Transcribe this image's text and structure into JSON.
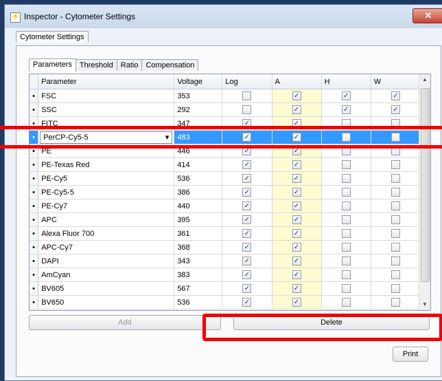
{
  "window": {
    "title": "Inspector - Cytometer Settings",
    "close_label": "✕",
    "app_icon": "⚡"
  },
  "outer_tab": "Cytometer Settings",
  "inner_tabs": [
    "Parameters",
    "Threshold",
    "Ratio",
    "Compensation"
  ],
  "columns": {
    "parameter": "Parameter",
    "voltage": "Voltage",
    "log": "Log",
    "a": "A",
    "h": "H",
    "w": "W"
  },
  "rows": [
    {
      "parameter": "FSC",
      "voltage": "353",
      "log": false,
      "a": true,
      "h": true,
      "w": true
    },
    {
      "parameter": "SSC",
      "voltage": "292",
      "log": false,
      "a": true,
      "h": true,
      "w": true
    },
    {
      "parameter": "FITC",
      "voltage": "347",
      "log": true,
      "a": true,
      "h": false,
      "w": false
    },
    {
      "parameter": "PerCP-Cy5-5",
      "voltage": "483",
      "log": true,
      "a": true,
      "h": false,
      "w": false
    },
    {
      "parameter": "PE",
      "voltage": "446",
      "log": true,
      "a": true,
      "h": false,
      "w": false
    },
    {
      "parameter": "PE-Texas Red",
      "voltage": "414",
      "log": true,
      "a": true,
      "h": false,
      "w": false
    },
    {
      "parameter": "PE-Cy5",
      "voltage": "536",
      "log": true,
      "a": true,
      "h": false,
      "w": false
    },
    {
      "parameter": "PE-Cy5-5",
      "voltage": "386",
      "log": true,
      "a": true,
      "h": false,
      "w": false
    },
    {
      "parameter": "PE-Cy7",
      "voltage": "440",
      "log": true,
      "a": true,
      "h": false,
      "w": false
    },
    {
      "parameter": "APC",
      "voltage": "395",
      "log": true,
      "a": true,
      "h": false,
      "w": false
    },
    {
      "parameter": "Alexa Fluor 700",
      "voltage": "361",
      "log": true,
      "a": true,
      "h": false,
      "w": false
    },
    {
      "parameter": "APC-Cy7",
      "voltage": "368",
      "log": true,
      "a": true,
      "h": false,
      "w": false
    },
    {
      "parameter": "DAPI",
      "voltage": "343",
      "log": true,
      "a": true,
      "h": false,
      "w": false
    },
    {
      "parameter": "AmCyan",
      "voltage": "383",
      "log": true,
      "a": true,
      "h": false,
      "w": false
    },
    {
      "parameter": "BV605",
      "voltage": "567",
      "log": true,
      "a": true,
      "h": false,
      "w": false
    },
    {
      "parameter": "BV650",
      "voltage": "536",
      "log": true,
      "a": true,
      "h": false,
      "w": false
    }
  ],
  "selected_row_index": 3,
  "buttons": {
    "add": "Add",
    "delete": "Delete",
    "print": "Print"
  },
  "colors": {
    "selection": "#3399ff",
    "column_a_highlight": "#fffcd3",
    "annotation_red": "#f20000"
  }
}
